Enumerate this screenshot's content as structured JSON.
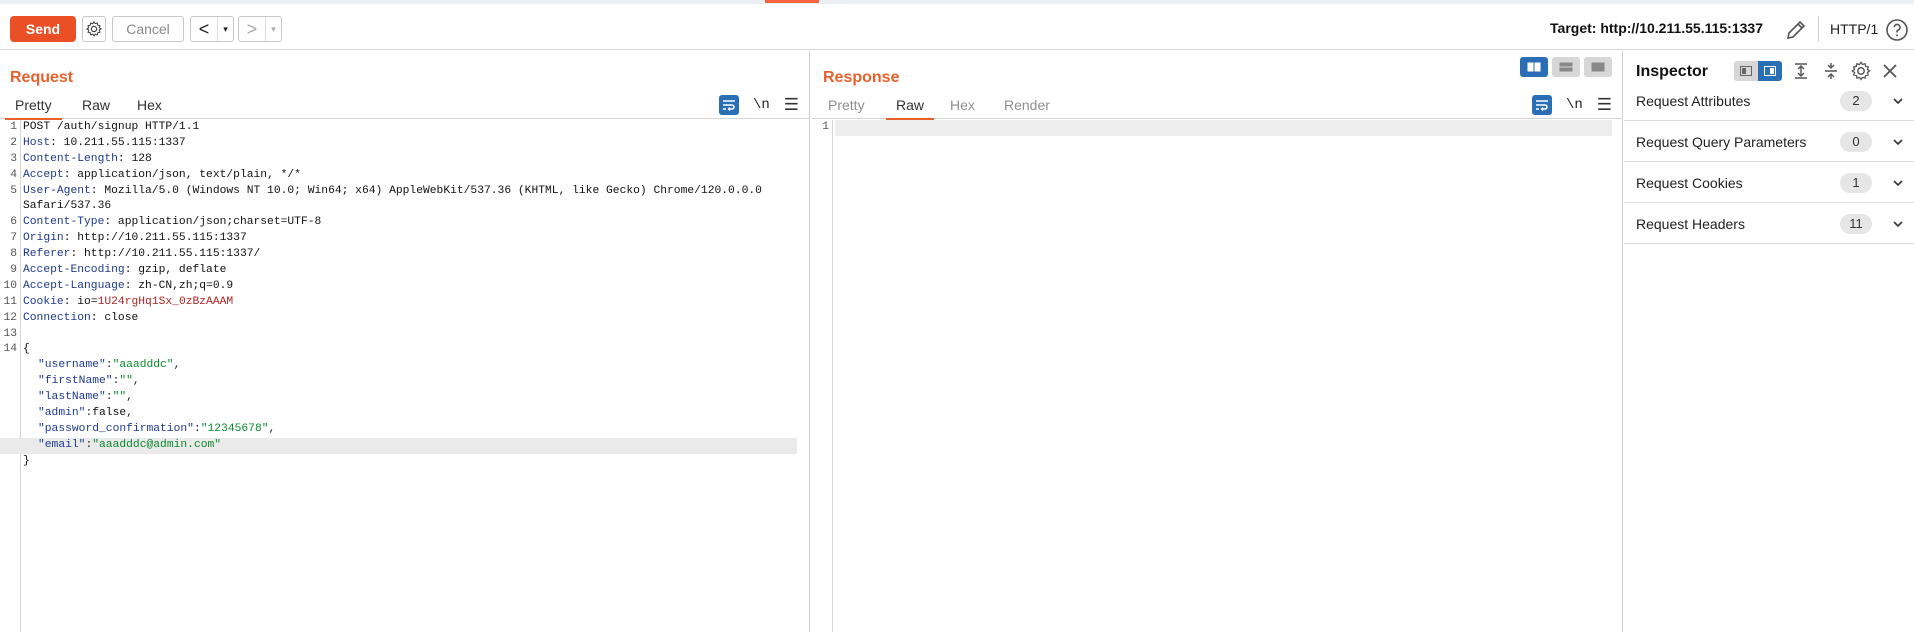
{
  "toolbar": {
    "send_label": "Send",
    "cancel_label": "Cancel",
    "back_label": "<",
    "forward_label": ">",
    "dropdown_arrow": "▾",
    "target_text": "Target: http://10.211.55.115:1337",
    "http_version": "HTTP/1",
    "accent_color": "#ea4f26"
  },
  "request": {
    "title": "Request",
    "tabs": [
      "Pretty",
      "Raw",
      "Hex"
    ],
    "selected_tab": "Pretty",
    "newline_label": "\\n",
    "lines": {
      "l1": "POST /auth/signup HTTP/1.1",
      "l2k": "Host",
      "l2v": ": 10.211.55.115:1337",
      "l3k": "Content-Length",
      "l3v": ": 128",
      "l4k": "Accept",
      "l4v": ": application/json, text/plain, */*",
      "l5k": "User-Agent",
      "l5v": ": Mozilla/5.0 (Windows NT 10.0; Win64; x64) AppleWebKit/537.36 (KHTML, like Gecko) Chrome/120.0.0.0",
      "l5b": "Safari/537.36",
      "l6k": "Content-Type",
      "l6v": ": application/json;charset=UTF-8",
      "l7k": "Origin",
      "l7v": ": http://10.211.55.115:1337",
      "l8k": "Referer",
      "l8v": ": http://10.211.55.115:1337/",
      "l9k": "Accept-Encoding",
      "l9v": ": gzip, deflate",
      "l10k": "Accept-Language",
      "l10v": ": zh-CN,zh;q=0.9",
      "l11k": "Cookie",
      "l11v": ": io=",
      "l11c": "1U24rgHq1Sx_0zBzAAAM",
      "l12k": "Connection",
      "l12v": ": close",
      "l14": "{",
      "j1k": "\"username\"",
      "j1v": "\"aaadddc\"",
      "j2k": "\"firstName\"",
      "j2v": "\"\"",
      "j3k": "\"lastName\"",
      "j3v": "\"\"",
      "j4k": "\"admin\"",
      "j4v": "false",
      "j5k": "\"password_confirmation\"",
      "j5v": "\"12345678\"",
      "j6k": "\"email\"",
      "j6v": "\"aaadddc@admin.com\"",
      "close": "}"
    },
    "colon": ":",
    "comma": ","
  },
  "response": {
    "title": "Response",
    "tabs": [
      "Pretty",
      "Raw",
      "Hex",
      "Render"
    ],
    "selected_tab": "Raw",
    "newline_label": "\\n",
    "line_number": "1"
  },
  "inspector": {
    "title": "Inspector",
    "sections": [
      {
        "label": "Request Attributes",
        "count": "2"
      },
      {
        "label": "Request Query Parameters",
        "count": "0"
      },
      {
        "label": "Request Cookies",
        "count": "1"
      },
      {
        "label": "Request Headers",
        "count": "11"
      }
    ]
  },
  "line_numbers": [
    "1",
    "2",
    "3",
    "4",
    "5",
    "",
    "6",
    "7",
    "8",
    "9",
    "10",
    "11",
    "12",
    "13",
    "14",
    "",
    "",
    "",
    "",
    "",
    "",
    "",
    ""
  ]
}
